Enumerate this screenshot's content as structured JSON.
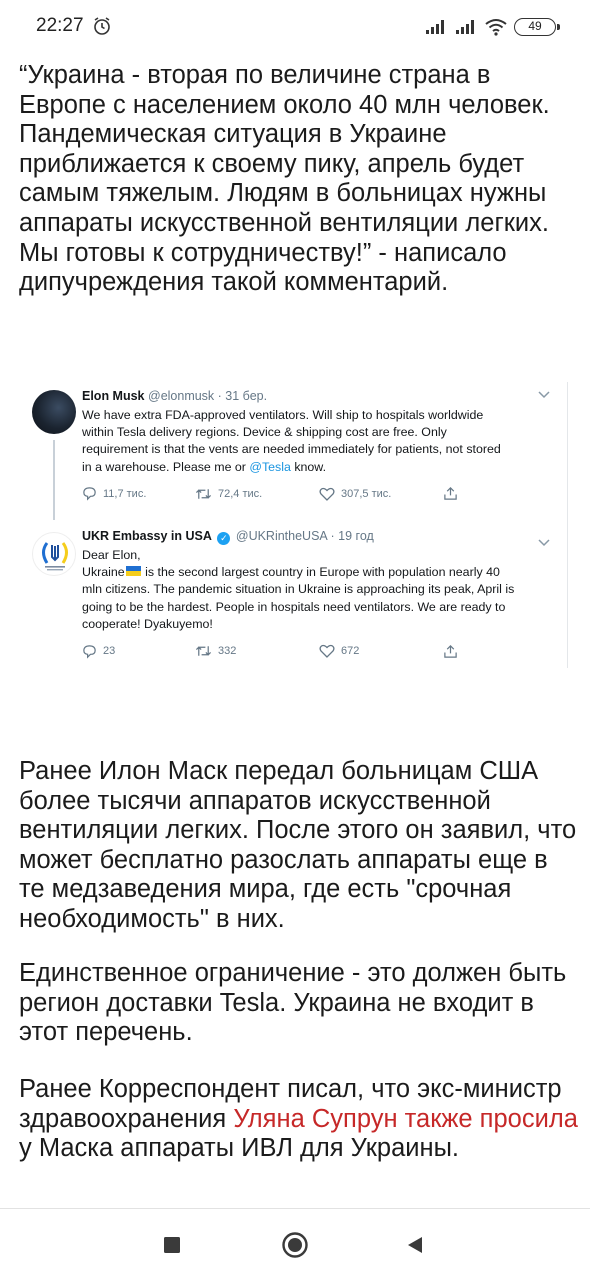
{
  "status_bar": {
    "time": "22:27",
    "battery": "49",
    "icons": [
      "alarm-icon",
      "signal-icon",
      "signal-icon",
      "wifi-icon",
      "battery-icon"
    ]
  },
  "article": {
    "quote": "“Украина - вторая по величине страна в Европе с населением около 40 млн человек. Пандемическая ситуация в Украине приближается к своему пику, апрель будет самым тяжелым. Людям в больницах нужны аппараты искусственной вентиляции легких. Мы готовы к сотрудничеству!” - написало дипучреждения такой комментарий.",
    "para2": "Ранее Илон Маск передал больницам США более тысячи аппаратов искусственной вентиляции легких. После этого он заявил, что может бесплатно разослать аппараты еще в те медзаведения мира, где есть \"срочная необходимость\" в них.",
    "para3": "Единственное ограничение - это должен быть регион доставки Tesla. Украина не входит в этот перечень.",
    "para4_before": "Ранее Корреспондент писал, что экс-министр здравоохранения ",
    "para4_link": "Уляна Супрун также просила",
    "para4_after": " у Маска аппараты ИВЛ для Украины."
  },
  "tweets": [
    {
      "name": "Elon Musk",
      "handle": "@elonmusk · 31 бер.",
      "lines": [
        "We have extra FDA-approved ventilators. Will ship to hospitals worldwide",
        "within Tesla delivery regions. Device & shipping cost are free. Only",
        "requirement is that the vents are needed immediately for patients, not stored"
      ],
      "last_before": "in a warehouse. Please me or ",
      "mention": "@Tesla",
      "last_after": " know.",
      "replies": "11,7 тис.",
      "retweets": "72,4 тис.",
      "likes": "307,5 тис."
    },
    {
      "name": "UKR Embassy in USA",
      "handle": "@UKRintheUSA · 19 год",
      "greeting": "Dear Elon,",
      "line1_before": "Ukraine",
      "line1_after": " is the second largest country in Europe with population nearly 40",
      "lines": [
        "mln citizens. The pandemic situation in Ukraine is approaching its peak, April is",
        "going to be the hardest. People in hospitals need ventilators. We are ready to",
        "cooperate! Dyakuyemo!"
      ],
      "replies": "23",
      "retweets": "332",
      "likes": "672"
    }
  ],
  "colors": {
    "link": "#c62828",
    "twitter_blue": "#1da1f2",
    "muted": "#657786"
  }
}
